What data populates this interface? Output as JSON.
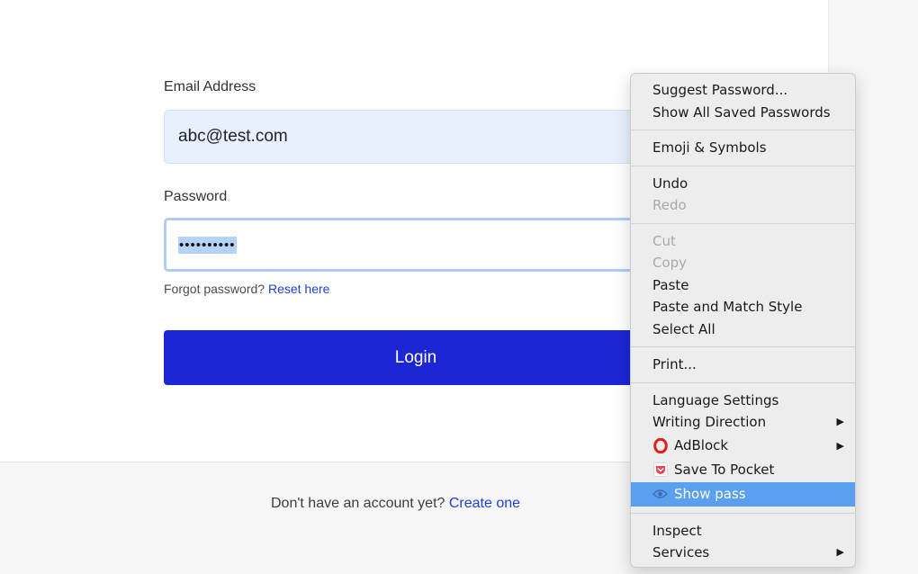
{
  "form": {
    "email_label": "Email Address",
    "email_value": "abc@test.com",
    "password_label": "Password",
    "password_value": "••••••••••",
    "forgot_text": "Forgot password?",
    "reset_link": "Reset here",
    "login_label": "Login",
    "signup_text": "Don't have an account yet?",
    "signup_link": "Create one"
  },
  "context_menu": {
    "suggest_password": "Suggest Password...",
    "show_saved_passwords": "Show All Saved Passwords",
    "emoji_symbols": "Emoji & Symbols",
    "undo": "Undo",
    "redo": "Redo",
    "cut": "Cut",
    "copy": "Copy",
    "paste": "Paste",
    "paste_match_style": "Paste and Match Style",
    "select_all": "Select All",
    "print": "Print...",
    "language_settings": "Language Settings",
    "writing_direction": "Writing Direction",
    "adblock": "AdBlock",
    "save_to_pocket": "Save To Pocket",
    "show_pass": "Show pass",
    "inspect": "Inspect",
    "services": "Services"
  },
  "colors": {
    "login_button": "#1c26d4",
    "link": "#1e3fd8",
    "menu_highlight": "#5a9ff0",
    "adblock_red": "#e0201b",
    "pocket_red": "#ef4056"
  },
  "icons": {
    "adblock": "opera-o-icon",
    "pocket": "pocket-icon",
    "show_pass": "eye-icon",
    "submenu": "submenu-arrow-icon"
  }
}
